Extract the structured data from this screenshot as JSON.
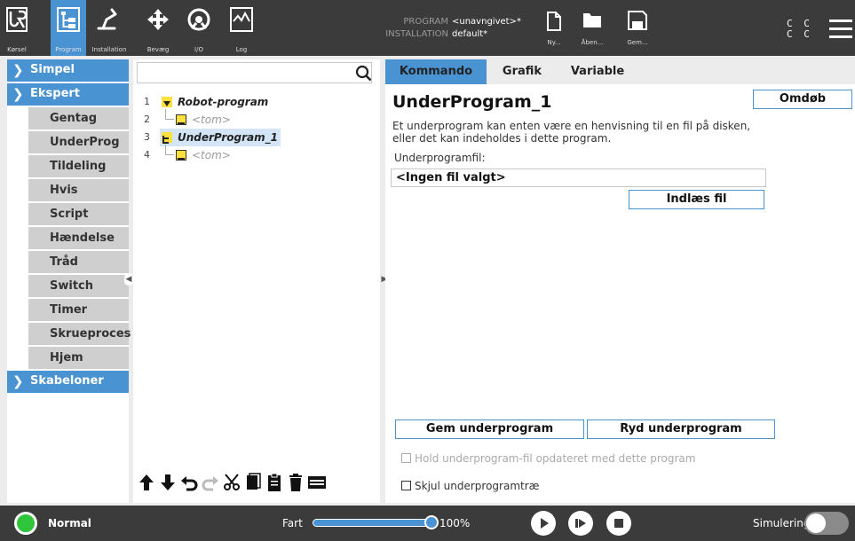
{
  "header": {
    "nav": [
      {
        "label": "Kørsel"
      },
      {
        "label": "Program"
      },
      {
        "label": "Installation"
      },
      {
        "label": "Bevæg"
      },
      {
        "label": "I/O"
      },
      {
        "label": "Log"
      }
    ],
    "program_key": "PROGRAM",
    "program_value": "<unavngivet>*",
    "installation_key": "INSTALLATION",
    "installation_value": "default*",
    "file_buttons": [
      {
        "label": "Ny..."
      },
      {
        "label": "Åben..."
      },
      {
        "label": "Gem..."
      }
    ],
    "cc_line1": "C C",
    "cc_line2": "C C",
    "active_color": "#4a93d2"
  },
  "leftnav": {
    "cat_simple": "Simpel",
    "cat_expert": "Ekspert",
    "items": [
      "Gentag",
      "UnderProg",
      "Tildeling",
      "Hvis",
      "Script",
      "Hændelse",
      "Tråd",
      "Switch",
      "Timer",
      "Skrueproces",
      "Hjem"
    ],
    "cat_templates": "Skabeloner"
  },
  "tree": {
    "search_placeholder": "",
    "rows": [
      {
        "num": "1",
        "label": "Robot-program"
      },
      {
        "num": "2",
        "label": "<tom>"
      },
      {
        "num": "3",
        "label": "UnderProgram_1"
      },
      {
        "num": "4",
        "label": "<tom>"
      }
    ]
  },
  "panel": {
    "tabs": [
      "Kommando",
      "Grafik",
      "Variable"
    ],
    "title": "UnderProgram_1",
    "rename_label": "Omdøb",
    "desc_line1": "Et underprogram kan enten være en henvisning til en fil på disken,",
    "desc_line2": "eller det kan indeholdes i dette program.",
    "file_label": "Underprogramfil:",
    "file_value": "<Ingen fil valgt>",
    "load_label": "Indlæs fil",
    "save_label": "Gem underprogram",
    "clear_label": "Ryd underprogram",
    "keep_updated_label": "Hold underprogram-fil opdateret med dette program",
    "hide_tree_label": "Skjul underprogramtræ"
  },
  "footer": {
    "status": "Normal",
    "status_color": "#2fc53a",
    "speed_label": "Fart",
    "speed_value": "100%",
    "speed_fraction": 1.0,
    "simulation_label": "Simulering"
  }
}
